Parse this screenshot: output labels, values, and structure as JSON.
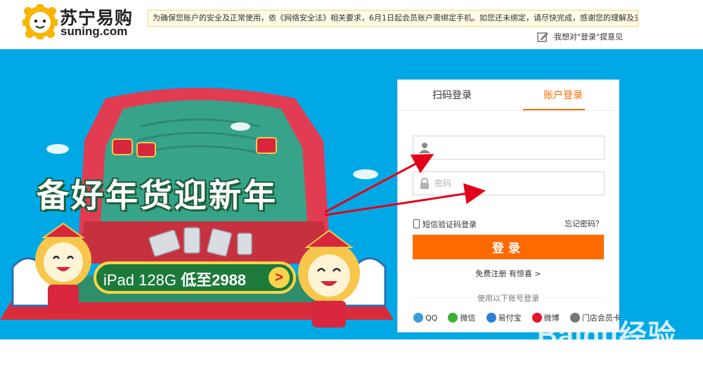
{
  "header": {
    "logo_cn": "苏宁易购",
    "logo_en": "suning.com",
    "notice": "为确保您账户的安全及正常使用，依《网络安全法》相关要求，6月1日起会员账户需绑定手机。如您还未绑定，请尽快完成，感谢您的理解及支持！",
    "feedback": "我想对\"登录\"提意见"
  },
  "banner": {
    "headline": "备好年货迎新年",
    "promo_plain": "iPad 128G",
    "promo_bold": "低至2988",
    "promo_go": ">"
  },
  "login": {
    "tabs": [
      {
        "label": "扫码登录",
        "active": false
      },
      {
        "label": "账户登录",
        "active": true
      }
    ],
    "username_placeholder": "",
    "password_placeholder": "密码",
    "sms_login": "短信验证码登录",
    "forgot_password": "忘记密码？",
    "login_button": "登录",
    "register": "免费注册 有惊喜 >",
    "other_accounts": "使用以下账号登录",
    "socials": [
      {
        "label": "QQ",
        "icon": "qq-icon",
        "color": "#3a9bdb"
      },
      {
        "label": "微信",
        "icon": "wechat-icon",
        "color": "#3cb034"
      },
      {
        "label": "易付宝",
        "icon": "yifubao-icon",
        "color": "#2f7fd6"
      },
      {
        "label": "微博",
        "icon": "weibo-icon",
        "color": "#e6162d"
      },
      {
        "label": "门店会员卡",
        "icon": "store-card-icon",
        "color": "#777777"
      }
    ],
    "accent_color": "#ff6a00"
  },
  "watermark": {
    "text": "Baidu经验",
    "url": "jingyan.baidu.com"
  }
}
